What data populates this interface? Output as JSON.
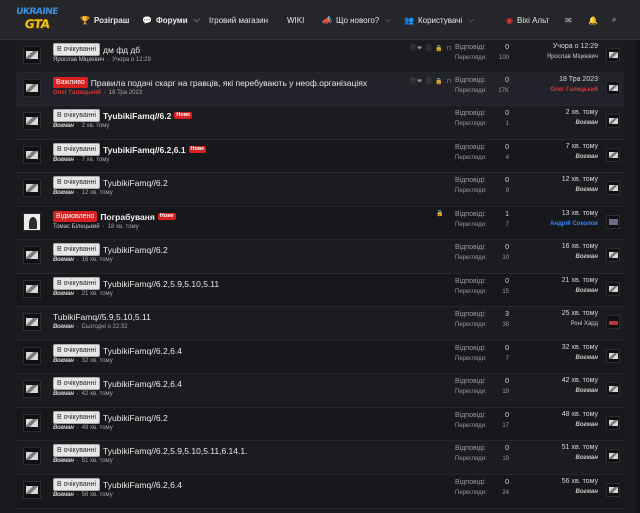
{
  "header": {
    "logo_line1": "UKRAINE",
    "logo_line2": "GTA",
    "nav": [
      {
        "label": "Розіграш"
      },
      {
        "label": "Форуми"
      },
      {
        "label": "Ігровий магазин"
      },
      {
        "label": "WIKI"
      },
      {
        "label": "Що нового?"
      },
      {
        "label": "Користувачі"
      }
    ],
    "user_label": "Віхі Альт"
  },
  "stat_labels": {
    "replies": "Відповіді:",
    "views": "Перегляди:"
  },
  "threads": [
    {
      "badge": "В очікуванні",
      "badge_type": "pending",
      "title": "дм фд дб",
      "bold": false,
      "new": "",
      "author": "Ярослав Міцкевич",
      "date": "Учора о 12:29",
      "replies": "0",
      "views": "100",
      "last_time": "Учора о 12:29",
      "last_user": "Ярослав Міцкевич",
      "icons": "ⓕ❤ ⓒ 🔒 ⊓"
    },
    {
      "badge": "Важливо",
      "badge_type": "important",
      "title": "Правила подачі скарг на гравців, які перебувають у неоф.організаціях",
      "bold": false,
      "new": "",
      "author": "Олег Галицький",
      "date": "18 Тра 2023",
      "replies": "0",
      "views": "17K",
      "last_time": "18 Тра 2023",
      "last_user": "Олег Галицький",
      "icons": "ⓕ❤ ⓒ 🔒 ⊓"
    },
    {
      "badge": "В очікуванні",
      "badge_type": "pending",
      "title": "TyubikiFamq//6.2",
      "bold": true,
      "new": "Нове",
      "author": "Boгмaн",
      "date": "2 хв. тому",
      "replies": "0",
      "views": "1",
      "last_time": "2 хв. тому",
      "last_user": "Boгмaн"
    },
    {
      "badge": "В очікуванні",
      "badge_type": "pending",
      "title": "TyubikiFamq//6.2,6.1",
      "bold": true,
      "new": "Нове",
      "author": "Boгмaн",
      "date": "7 хв. тому",
      "replies": "0",
      "views": "4",
      "last_time": "7 хв. тому",
      "last_user": "Boгмaн"
    },
    {
      "badge": "В очікуванні",
      "badge_type": "pending",
      "title": "TyubikiFamq//6.2",
      "bold": false,
      "new": "",
      "author": "Boгмaн",
      "date": "12 хв. тому",
      "replies": "0",
      "views": "9",
      "last_time": "12 хв. тому",
      "last_user": "Boгмaн"
    },
    {
      "badge": "Відмовлено",
      "badge_type": "rejected",
      "title": "Пограбуваня",
      "bold": true,
      "new": "Нове",
      "author": "Томас Білецький",
      "date": "18 хв. тому",
      "replies": "1",
      "views": "7",
      "last_time": "13 хв. тому",
      "last_user": "Андрій Соколов",
      "icons": "🔒"
    },
    {
      "badge": "В очікуванні",
      "badge_type": "pending",
      "title": "TyubikiFamq//6.2",
      "bold": false,
      "new": "",
      "author": "Boгмaн",
      "date": "16 хв. тому",
      "replies": "0",
      "views": "10",
      "last_time": "16 хв. тому",
      "last_user": "Boгмaн"
    },
    {
      "badge": "В очікуванні",
      "badge_type": "pending",
      "title": "TyubikiFamq//6.2,5.9,5.10,5.11",
      "bold": false,
      "new": "",
      "author": "Boгмaн",
      "date": "21 хв. тому",
      "replies": "0",
      "views": "15",
      "last_time": "21 хв. тому",
      "last_user": "Boгмaн"
    },
    {
      "badge": "",
      "badge_type": "",
      "title": "TubikiFamq//5.9,5.10,5.11",
      "bold": false,
      "new": "",
      "author": "Boгмaн",
      "date": "Сьогодні о 22:32",
      "replies": "3",
      "views": "38",
      "last_time": "25 хв. тому",
      "last_user": "Роні Хард"
    },
    {
      "badge": "В очікуванні",
      "badge_type": "pending",
      "title": "TyubikiFamq//6.2,6.4",
      "bold": false,
      "new": "",
      "author": "Boгмaн",
      "date": "32 хв. тому",
      "replies": "0",
      "views": "7",
      "last_time": "32 хв. тому",
      "last_user": "Boгмaн"
    },
    {
      "badge": "В очікуванні",
      "badge_type": "pending",
      "title": "TyubikiFamq//6.2,6.4",
      "bold": false,
      "new": "",
      "author": "Boгмaн",
      "date": "42 хв. тому",
      "replies": "0",
      "views": "19",
      "last_time": "42 хв. тому",
      "last_user": "Boгмaн"
    },
    {
      "badge": "В очікуванні",
      "badge_type": "pending",
      "title": "TyubikiFamq//6.2",
      "bold": false,
      "new": "",
      "author": "Boгмaн",
      "date": "48 хв. тому",
      "replies": "0",
      "views": "17",
      "last_time": "48 хв. тому",
      "last_user": "Boгмaн"
    },
    {
      "badge": "В очікуванні",
      "badge_type": "pending",
      "title": "TyubikiFamq//6.2,5.9,5.10,5.11,6.14.1.",
      "bold": false,
      "new": "",
      "author": "Boгмaн",
      "date": "51 хв. тому",
      "replies": "0",
      "views": "19",
      "last_time": "51 хв. тому",
      "last_user": "Boгмaн"
    },
    {
      "badge": "В очікуванні",
      "badge_type": "pending",
      "title": "TyubikiFamq//6.2,6.4",
      "bold": false,
      "new": "",
      "author": "Boгмaн",
      "date": "56 хв. тому",
      "replies": "0",
      "views": "24",
      "last_time": "56 хв. тому",
      "last_user": "Boгмaн"
    }
  ]
}
